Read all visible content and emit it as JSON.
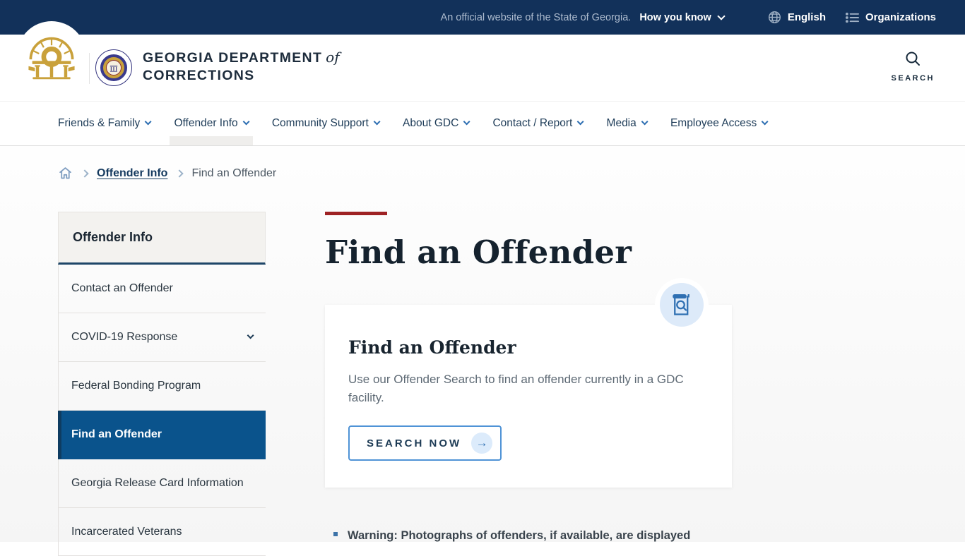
{
  "topbar": {
    "official_text": "An official website of the State of Georgia.",
    "how_you_know": "How you know",
    "english": "English",
    "organizations": "Organizations"
  },
  "header": {
    "agency_line1": "GEORGIA DEPARTMENT",
    "agency_of": "of",
    "agency_line2": "CORRECTIONS",
    "search_label": "SEARCH"
  },
  "nav": {
    "items": [
      {
        "label": "Friends & Family"
      },
      {
        "label": "Offender Info"
      },
      {
        "label": "Community Support"
      },
      {
        "label": "About GDC"
      },
      {
        "label": "Contact / Report"
      },
      {
        "label": "Media"
      },
      {
        "label": "Employee Access"
      }
    ]
  },
  "breadcrumb": {
    "link1": "Offender Info",
    "current": "Find an Offender"
  },
  "sidebar": {
    "title": "Offender Info",
    "items": [
      {
        "label": "Contact an Offender"
      },
      {
        "label": "COVID-19 Response"
      },
      {
        "label": "Federal Bonding Program"
      },
      {
        "label": "Find an Offender"
      },
      {
        "label": "Georgia Release Card Information"
      },
      {
        "label": "Incarcerated Veterans"
      }
    ]
  },
  "main": {
    "page_title": "Find an Offender",
    "card": {
      "title": "Find an Offender",
      "body": "Use our Offender Search to find an offender currently in a GDC facility.",
      "button_label": "SEARCH NOW",
      "arrow": "→"
    },
    "warning": "Warning: Photographs of offenders, if available, are displayed"
  },
  "colors": {
    "topbar_bg": "#12315a",
    "accent_red": "#9e2224",
    "active_blue": "#0a538c",
    "link_blue": "#2e6fb2",
    "gold": "#c9a13b"
  }
}
